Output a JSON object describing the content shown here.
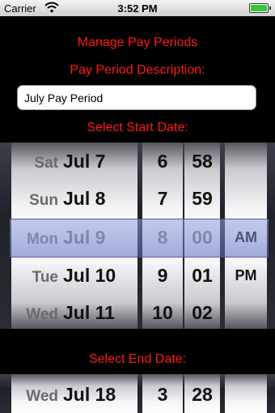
{
  "status_bar": {
    "carrier": "Carrier",
    "time": "3:52 PM",
    "battery_level": 1.0,
    "battery_color": "#39c43a"
  },
  "page": {
    "title": "Manage Pay Periods",
    "description_label": "Pay Period Description:",
    "description_value": "July Pay Period",
    "start_label": "Select Start Date:",
    "end_label": "Select End Date:",
    "label_color": "#ff1a1a"
  },
  "start_picker": {
    "dates": [
      {
        "dow": "Sat",
        "md": "Jul 7"
      },
      {
        "dow": "Sun",
        "md": "Jul 8"
      },
      {
        "dow": "Mon",
        "md": "Jul 9"
      },
      {
        "dow": "Tue",
        "md": "Jul 10"
      },
      {
        "dow": "Wed",
        "md": "Jul 11"
      }
    ],
    "hours": [
      "6",
      "7",
      "8",
      "9",
      "10"
    ],
    "minutes": [
      "58",
      "59",
      "00",
      "01",
      "02"
    ],
    "ampm": [
      "",
      "",
      "AM",
      "PM",
      ""
    ]
  },
  "end_picker": {
    "dates": [
      {
        "dow": "Wed",
        "md": "Jul 18"
      }
    ],
    "hours": [
      "3"
    ],
    "minutes": [
      "28"
    ]
  }
}
